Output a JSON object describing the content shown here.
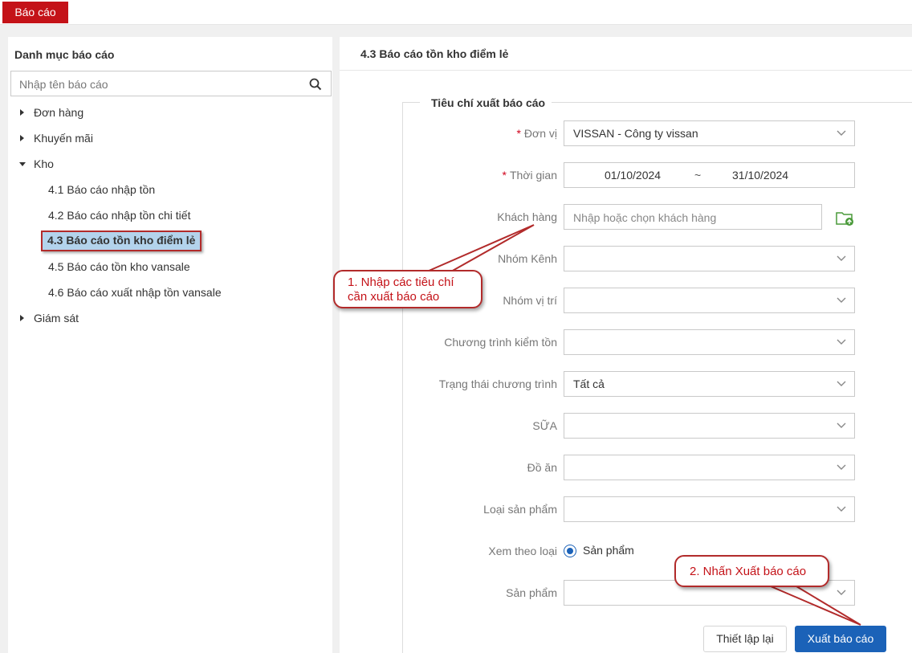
{
  "topbar": {
    "tab_label": "Báo cáo"
  },
  "sidebar": {
    "title": "Danh mục báo cáo",
    "search_placeholder": "Nhập tên báo cáo",
    "groups": [
      {
        "label": "Đơn hàng",
        "expanded": false
      },
      {
        "label": "Khuyến mãi",
        "expanded": false
      },
      {
        "label": "Kho",
        "expanded": true
      },
      {
        "label": "Giám sát",
        "expanded": false
      }
    ],
    "kho_items": [
      {
        "label": "4.1 Báo cáo nhập tồn"
      },
      {
        "label": "4.2 Báo cáo nhập tồn chi tiết"
      },
      {
        "label": "4.3 Báo cáo tồn kho điểm lẻ",
        "selected": true
      },
      {
        "label": "4.5 Báo cáo tồn kho vansale"
      },
      {
        "label": "4.6 Báo cáo xuất nhập tồn vansale"
      }
    ]
  },
  "main": {
    "title": "4.3 Báo cáo tồn kho điểm lẻ",
    "legend": "Tiêu chí xuất báo cáo",
    "fields": {
      "don_vi": {
        "label": "Đơn vị",
        "required": true,
        "value": "VISSAN - Công ty vissan"
      },
      "thoi_gian": {
        "label": "Thời gian",
        "required": true,
        "from": "01/10/2024",
        "separator": "~",
        "to": "31/10/2024"
      },
      "khach_hang": {
        "label": "Khách hàng",
        "placeholder": "Nhập hoặc chọn khách hàng"
      },
      "nhom_kenh": {
        "label": "Nhóm Kênh",
        "value": ""
      },
      "nhom_vi_tri": {
        "label": "Nhóm vị trí",
        "value": ""
      },
      "chuong_trinh": {
        "label": "Chương trình kiểm tồn",
        "value": ""
      },
      "trang_thai": {
        "label": "Trạng thái chương trình",
        "value": "Tất cả"
      },
      "sua": {
        "label": "SỮA",
        "value": ""
      },
      "do_an": {
        "label": "Đồ ăn",
        "value": ""
      },
      "loai_san_pham": {
        "label": "Loại sản phẩm",
        "value": ""
      },
      "xem_theo_loai": {
        "label": "Xem theo loại",
        "option": "Sản phẩm",
        "selected": true
      },
      "san_pham": {
        "label": "Sản phẩm",
        "value": ""
      }
    },
    "buttons": {
      "reset": "Thiết lập lại",
      "export": "Xuất báo cáo"
    }
  },
  "annotations": {
    "callout_1_line1": "1. Nhập các tiêu chí",
    "callout_1_line2": "cần xuất báo cáo",
    "callout_2": "2. Nhấn Xuất báo cáo"
  },
  "colors": {
    "brand_red": "#c41218",
    "primary_blue": "#1b62b8",
    "selected_bg": "#b3d3ec",
    "callout_border": "#b22b2b"
  }
}
